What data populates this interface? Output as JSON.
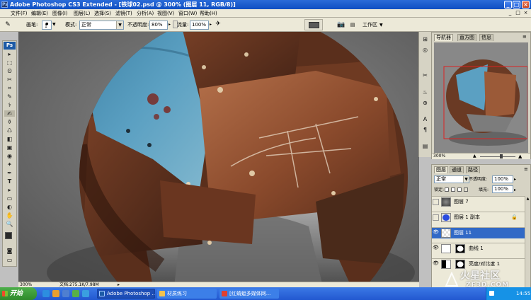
{
  "window": {
    "title": "Adobe Photoshop CS3 Extended - [铁球02.psd @ 300% (图层 11, RGB/8)]",
    "icon_text": "Ps",
    "minimize": "_",
    "maximize": "□",
    "close": "×"
  },
  "menu": {
    "items": [
      "文件(F)",
      "编辑(E)",
      "图像(I)",
      "图层(L)",
      "选择(S)",
      "滤镜(T)",
      "分析(A)",
      "视图(V)",
      "窗口(W)",
      "帮助(H)"
    ],
    "doc_min": "_",
    "doc_max": "□",
    "doc_close": "×"
  },
  "options": {
    "brush_label": "画笔:",
    "brush_size": "1",
    "mode_label": "模式:",
    "mode_value": "正常",
    "opacity_label": "不透明度:",
    "opacity_value": "80%",
    "flow_label": "流量:",
    "flow_value": "100%",
    "workspace_label": "工作区"
  },
  "toolbox": {
    "logo": "Ps",
    "tools": [
      "▸",
      "⬚",
      "ʘ",
      "✂",
      "⌗",
      "✎",
      "⚕",
      "✍",
      "⚱",
      "♺",
      "◧",
      "▣",
      "◉",
      "✦",
      "✒",
      "T",
      "▸",
      "▭",
      "✋",
      "🔍",
      "◐",
      "◙",
      "▭"
    ]
  },
  "canvas": {
    "zoom": "300%",
    "doc_info": "文档:275.1K/7.98M"
  },
  "mini_panel": {
    "icons": [
      "⊞",
      "◎",
      "✂",
      "♨",
      "⊕",
      "A",
      "¶",
      "▤",
      "◩"
    ]
  },
  "navigator": {
    "tabs": [
      "导航器",
      "直方图",
      "信息"
    ],
    "zoom": "300%"
  },
  "layers": {
    "tabs": [
      "图层",
      "通道",
      "路径"
    ],
    "blend_mode": "正常",
    "opacity_label": "不透明度:",
    "opacity_value": "100%",
    "lock_label": "锁定:",
    "fill_label": "填充:",
    "fill_value": "100%",
    "rows": [
      {
        "name": "图层 7",
        "visible": false
      },
      {
        "name": "图层 1 副本",
        "visible": false
      },
      {
        "name": "图层 11",
        "visible": true,
        "selected": true
      },
      {
        "name": "曲线 1",
        "visible": true
      },
      {
        "name": "亮度/对比度 1",
        "visible": true
      }
    ]
  },
  "taskbar": {
    "start": "开始",
    "tasks": [
      "Adobe Photoshop ...",
      "材质练习",
      "[红蜻蜓多媒体网..."
    ],
    "time": "14:55"
  },
  "watermark": {
    "line1": "火星社区",
    "line2": "ZF3D.COM"
  },
  "colors": {
    "titlebar": "#0f4fc2",
    "selection": "#3169c6",
    "rust": "#8a4a2c",
    "teal": "#4d8fb0"
  }
}
